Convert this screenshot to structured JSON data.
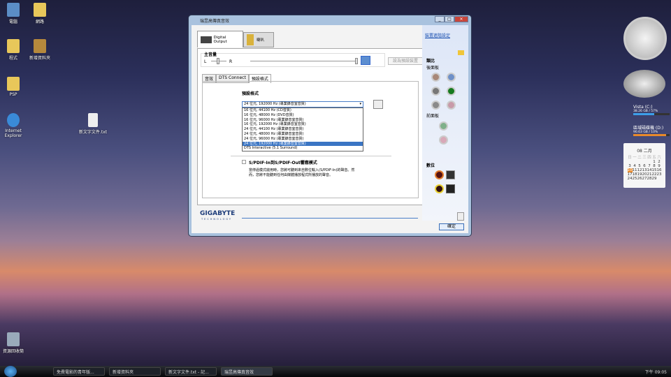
{
  "desktop": {
    "icons": [
      "電腦",
      "網路",
      "程式",
      "新增資料夾",
      "PSP",
      "Internet Explorer",
      "新文字文件.txt",
      "資源回收筒"
    ]
  },
  "window": {
    "title": "瑞昱高傳真音效",
    "device_tabs": [
      "Digital Output",
      "喇叭"
    ],
    "volume": {
      "label": "主音量",
      "left": "L",
      "right": "R",
      "balance": 0.5,
      "level": 1.0,
      "set_default": "設為預設裝置"
    },
    "sub_tabs": [
      "音效",
      "DTS Connect",
      "預設格式"
    ],
    "format": {
      "label": "預設格式",
      "selected": "24 位元, 192000 Hz (專業錄音室音質)",
      "options": [
        "16 位元, 44100 Hz (CD音質)",
        "16 位元, 48000 Hz (DVD音質)",
        "16 位元, 96000 Hz (專業錄音室音質)",
        "16 位元, 192000 Hz (專業錄音室音質)",
        "24 位元, 44100 Hz (專業錄音室音質)",
        "24 位元, 48000 Hz (專業錄音室音質)",
        "24 位元, 96000 Hz (專業錄音室音質)",
        "24 位元, 192000 Hz (專業錄音室音質)",
        "DTS Interactive (5.1 Surround)"
      ]
    },
    "spdif": {
      "label": "S/PDIF-In到S/PDIF-Out響應模式",
      "desc": "當停過模式啟用時，您將可聽到來自數位輸入(S/PDIF-In)的聲音。然而，您將不能聽到任何由媒體播放程式所播放的聲音。"
    },
    "brand": "GIGABYTE",
    "brand_sub": "TECHNOLOGY",
    "ok": "確定",
    "side": {
      "advanced": "裝置進階設定",
      "analog": "類比",
      "back": "後面板",
      "front": "前面板",
      "digital": "數位"
    }
  },
  "gadgets": {
    "drives": [
      {
        "name": "Vista (C:)",
        "info": "38.26 GB / 57%",
        "used": 0.57
      },
      {
        "name": "區域磁碟機 (D:)",
        "info": "90.63 GB / 10%",
        "used": 0.9
      }
    ],
    "calendar": {
      "header": "08 二月",
      "weekdays": [
        "日",
        "一",
        "二",
        "三",
        "四",
        "五",
        "六"
      ],
      "today": "10",
      "weeks": [
        [
          "",
          "",
          "",
          "",
          "",
          "1",
          "2"
        ],
        [
          "3",
          "4",
          "5",
          "6",
          "7",
          "8",
          "9"
        ],
        [
          "10",
          "11",
          "12",
          "13",
          "14",
          "15",
          "16"
        ],
        [
          "17",
          "18",
          "19",
          "20",
          "21",
          "22",
          "23"
        ],
        [
          "24",
          "25",
          "26",
          "27",
          "28",
          "29",
          ""
        ]
      ]
    }
  },
  "taskbar": {
    "items": [
      "免費電影的青年版...",
      "新增資料夾",
      "新文字文件.txt - 記...",
      "瑞昱高傳真音效"
    ],
    "clock": "下午 09:05"
  }
}
